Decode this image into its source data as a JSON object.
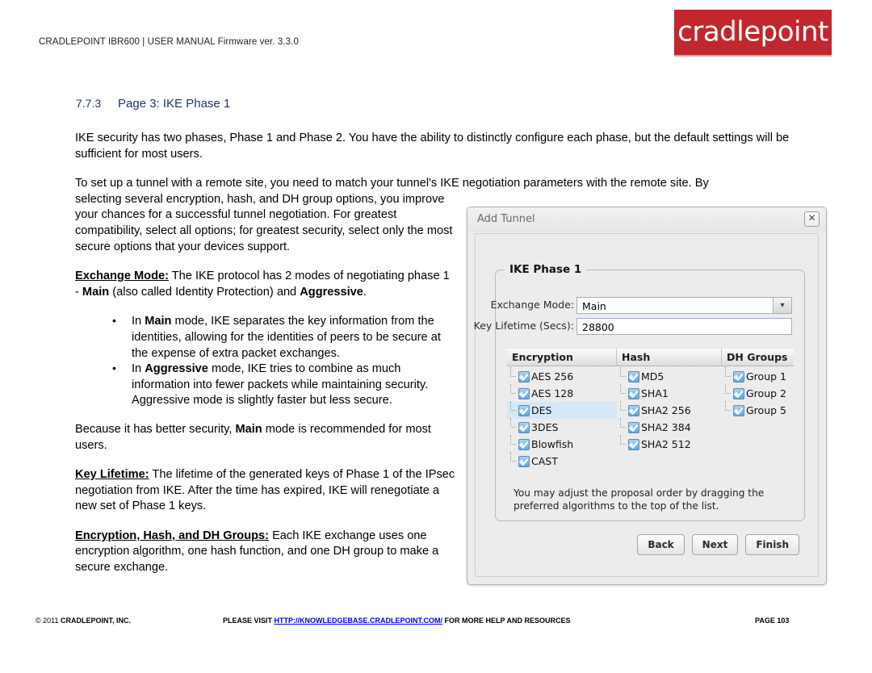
{
  "header": {
    "doc_line": "CRADLEPOINT IBR600 | USER MANUAL Firmware ver. 3.3.0",
    "logo_text": "cradlepoint",
    "logo_color": "#c1272d"
  },
  "section": {
    "number": "7.7.3",
    "title": "Page 3: IKE Phase 1",
    "heading_color": "#1f3864"
  },
  "body": {
    "p1": "IKE security has two phases, Phase 1 and Phase 2. You have the ability to distinctly configure each phase, but the default settings will be sufficient for most users.",
    "p2_full": "To set up a tunnel with a remote site, you need to match your tunnel's IKE negotiation parameters with the remote site. By",
    "p2_rest": "selecting several encryption, hash, and DH group options, you improve your chances for a successful tunnel negotiation. For greatest compatibility, select all options; for greatest security, select only the most secure options that your devices support.",
    "exchange_mode_term": "Exchange Mode:",
    "exchange_mode_text_a": " The IKE protocol has 2 modes of negotiating phase 1 - ",
    "exchange_mode_bold_main": "Main",
    "exchange_mode_text_b": " (also called Identity Protection) and ",
    "exchange_mode_bold_aggr": "Aggressive",
    "exchange_mode_text_c": ".",
    "bullets": [
      {
        "pre": "In ",
        "bold": "Main",
        "post": " mode, IKE separates the key information from the identities, allowing for the identities of peers to be secure at the expense of extra packet exchanges."
      },
      {
        "pre": "In ",
        "bold": "Aggressive",
        "post": " mode, IKE tries to combine as much information into fewer packets while maintaining security. Aggressive mode is slightly faster but less secure."
      }
    ],
    "p3_a": "Because it has better security, ",
    "p3_bold": "Main",
    "p3_b": " mode is recommended for most users.",
    "key_lifetime_term": "Key Lifetime:",
    "key_lifetime_text": " The lifetime of the generated keys of Phase 1 of the IPsec negotiation from IKE. After the time has expired, IKE will renegotiate a new set of Phase 1 keys.",
    "enc_hash_dh_term": "Encryption, Hash, and DH Groups:",
    "enc_hash_dh_text": " Each IKE exchange uses one encryption algorithm, one hash function, and one DH group to make a secure exchange."
  },
  "dialog": {
    "title": "Add Tunnel",
    "close_icon": "✕",
    "fieldset_legend": "IKE Phase 1",
    "fields": [
      {
        "label": "Exchange Mode:",
        "value": "Main",
        "type": "select"
      },
      {
        "label": "Key Lifetime (Secs):",
        "value": "28800",
        "type": "text"
      }
    ],
    "select_arrow_icon": "▼",
    "columns": [
      {
        "header": "Encryption",
        "items": [
          {
            "label": "AES 256",
            "checked": true,
            "selected": false
          },
          {
            "label": "AES 128",
            "checked": true,
            "selected": false
          },
          {
            "label": "DES",
            "checked": true,
            "selected": true
          },
          {
            "label": "3DES",
            "checked": true,
            "selected": false
          },
          {
            "label": "Blowfish",
            "checked": true,
            "selected": false
          },
          {
            "label": "CAST",
            "checked": true,
            "selected": false
          }
        ]
      },
      {
        "header": "Hash",
        "items": [
          {
            "label": "MD5",
            "checked": true,
            "selected": false
          },
          {
            "label": "SHA1",
            "checked": true,
            "selected": false
          },
          {
            "label": "SHA2 256",
            "checked": true,
            "selected": false
          },
          {
            "label": "SHA2 384",
            "checked": true,
            "selected": false
          },
          {
            "label": "SHA2 512",
            "checked": true,
            "selected": false
          }
        ]
      },
      {
        "header": "DH Groups",
        "items": [
          {
            "label": "Group 1",
            "checked": true,
            "selected": false
          },
          {
            "label": "Group 2",
            "checked": true,
            "selected": false
          },
          {
            "label": "Group 5",
            "checked": true,
            "selected": false
          }
        ]
      }
    ],
    "hint": "You may adjust the proposal order by dragging the preferred algorithms to the top of the list.",
    "buttons": [
      "Back",
      "Next",
      "Finish"
    ],
    "selection_highlight_color": "#d6e7f8",
    "checkbox_color": "#5ea8e0"
  },
  "footer": {
    "copyright_mark": "© 2011 ",
    "copyright": "CRADLEPOINT, INC.",
    "visit_pre": "PLEASE VISIT ",
    "link": "HTTP://KNOWLEDGEBASE.CRADLEPOINT.COM/",
    "visit_post": " FOR MORE HELP AND RESOURCES",
    "page": "PAGE 103",
    "link_color": "#0000ee"
  }
}
